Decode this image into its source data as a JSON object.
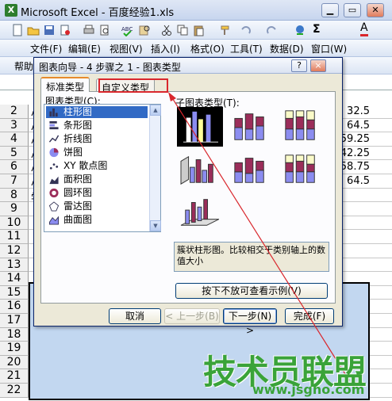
{
  "window": {
    "title": "Microsoft Excel - 百度经验1.xls"
  },
  "menubar": {
    "items": [
      "文件(F)",
      "编辑(E)",
      "视图(V)",
      "插入(I)",
      "格式(O)",
      "工具(T)",
      "数据(D)",
      "窗口(W)"
    ]
  },
  "toolbar2": {
    "help_label": "帮助(",
    "sigma": "Σ",
    "font_color_glyph": "A"
  },
  "rows": {
    "numbers": [
      "2",
      "3",
      "4",
      "5",
      "6",
      "7",
      "8",
      "9",
      "10",
      "11",
      "12",
      "13",
      "14",
      "15",
      "16",
      "17",
      "18",
      "19",
      "20",
      "21",
      "22"
    ],
    "values": [
      "32.5",
      "64.5",
      "59.25",
      "42.25",
      "58.75",
      "64.5"
    ],
    "left_chars": [
      "小",
      "小",
      "小",
      "小",
      "小",
      "小",
      "学"
    ]
  },
  "dialog": {
    "title": "图表向导 - 4 步骤之 1 - 图表类型",
    "help_btn": "?",
    "close_btn": "×",
    "tabs": {
      "standard": "标准类型",
      "custom": "自定义类型"
    },
    "chart_type_label": "图表类型(C):",
    "subtype_label": "子图表类型(T):",
    "chart_types": [
      "柱形图",
      "条形图",
      "折线图",
      "饼图",
      "XY 散点图",
      "面积图",
      "圆环图",
      "雷达图",
      "曲面图"
    ],
    "selected_type": "柱形图",
    "description": "簇状柱形图。比较相交于类别轴上的数值大小",
    "preview_button": "按下不放可查看示例(V)",
    "buttons": {
      "cancel": "取消",
      "back": "< 上一步(B)",
      "next": "下一步(N) >",
      "finish": "完成(F)"
    }
  },
  "watermark": {
    "text": "技术员联盟",
    "url": "www.jsgho.com"
  },
  "colors": {
    "accent_select": "#316ac5",
    "highlight_red": "#d9272d",
    "watermark_green": "#3aa339",
    "bar_blue": "#8b8cf0",
    "bar_maroon": "#9b2d5a",
    "bar_cream": "#fafac8"
  }
}
